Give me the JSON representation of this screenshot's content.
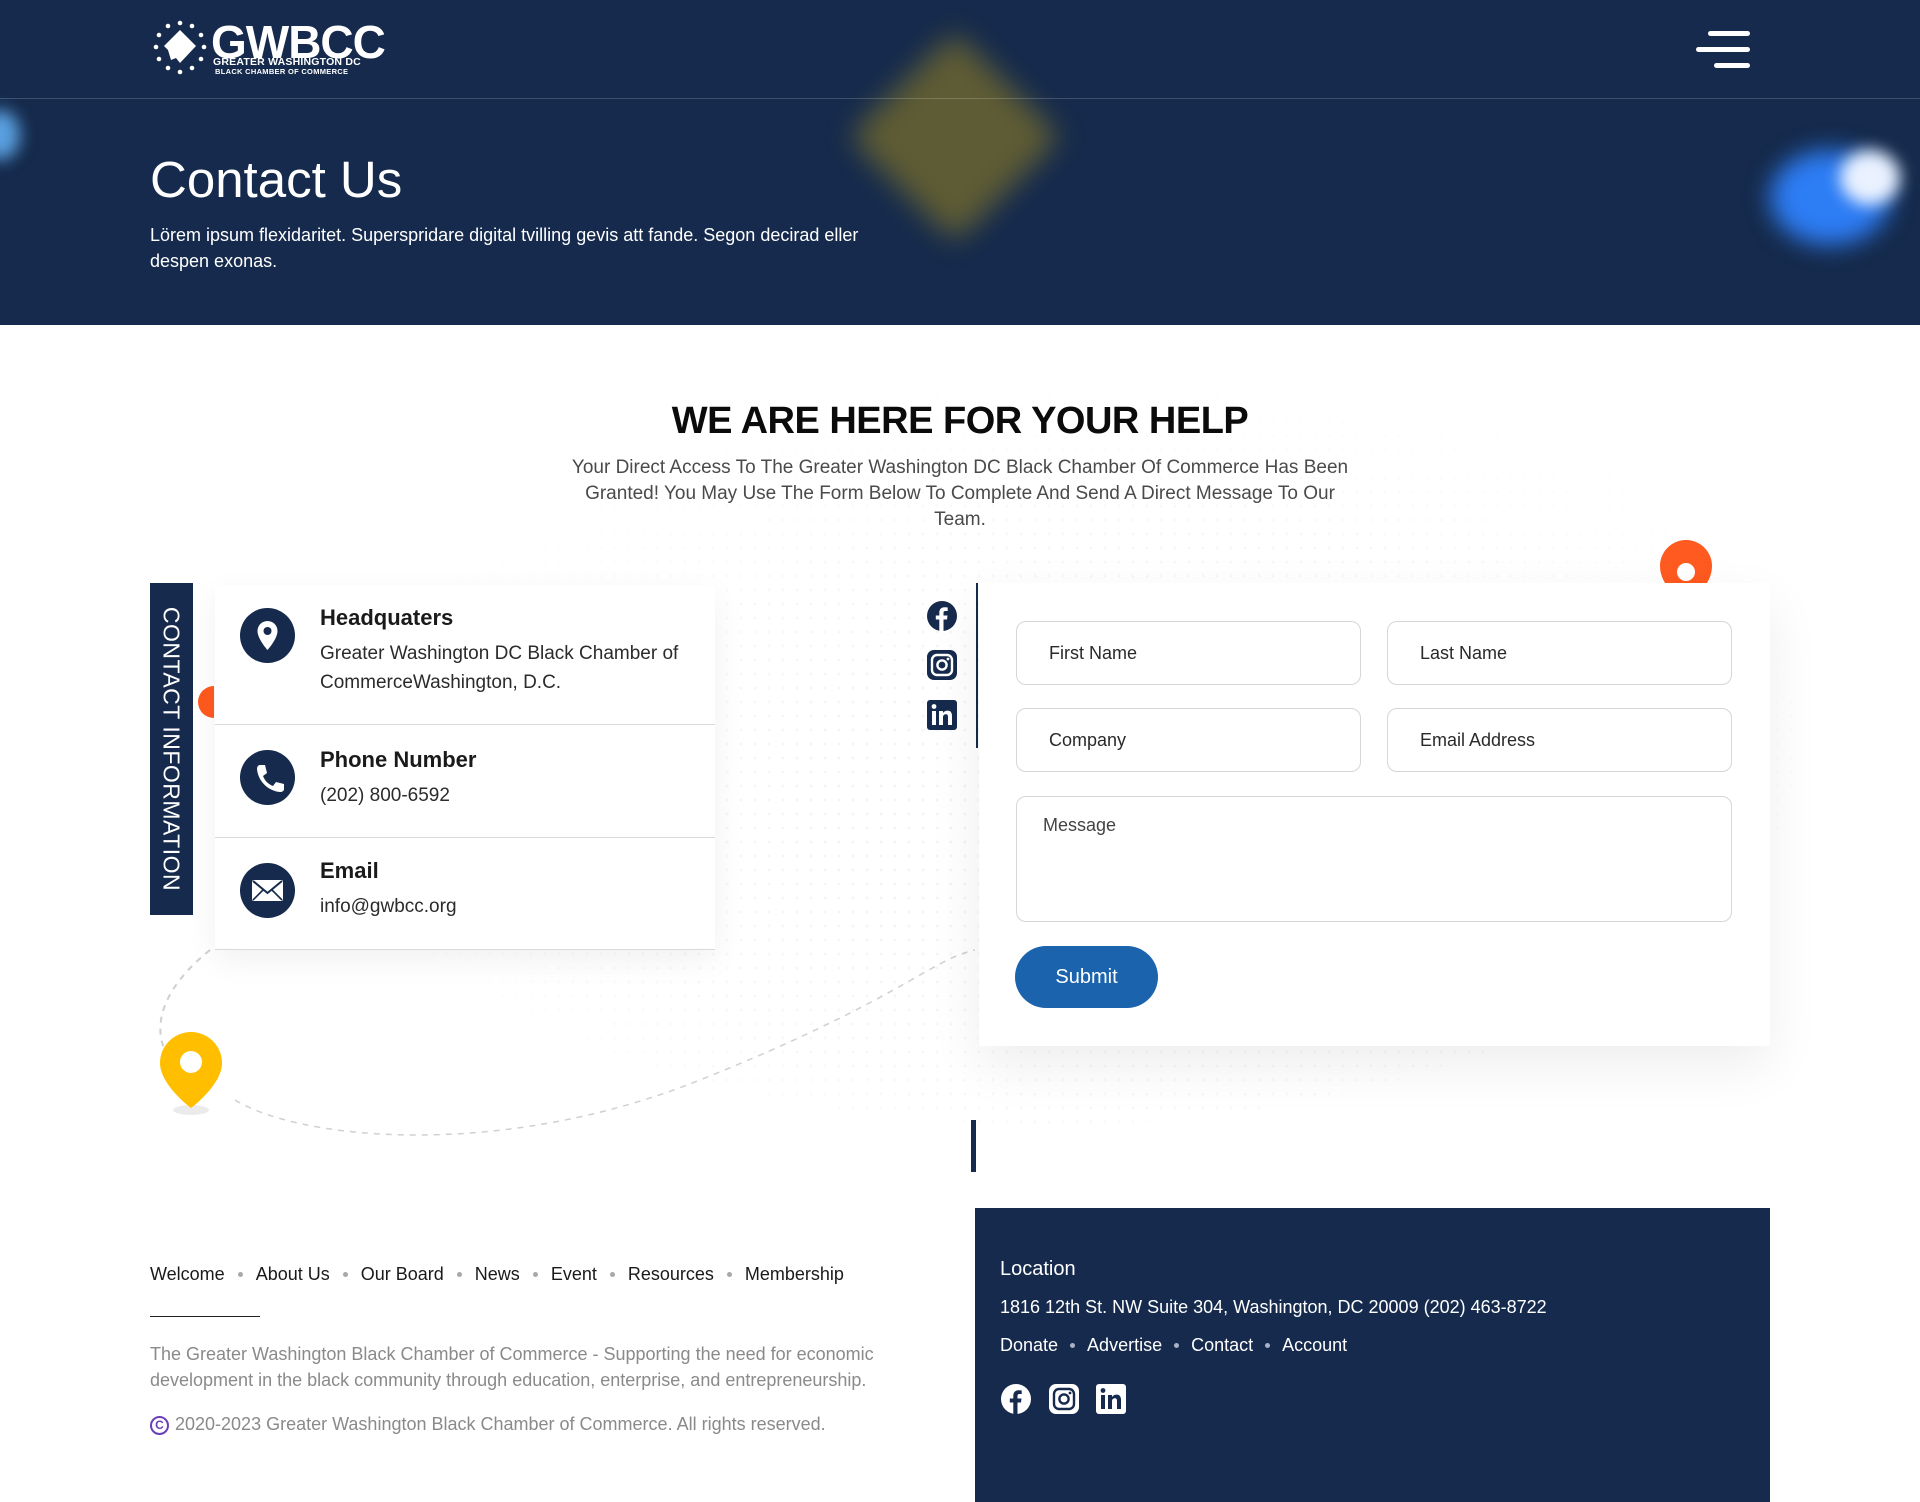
{
  "header": {
    "logo_text": "GWBCC",
    "logo_line1": "GREATER WASHINGTON DC",
    "logo_line2": "BLACK CHAMBER OF COMMERCE",
    "menu_icon": "hamburger-menu-icon"
  },
  "hero": {
    "title": "Contact Us",
    "subtitle": "Lörem ipsum flexidaritet. Superspridare digital tvilling gevis att fande. Segon decirad eller despen exonas."
  },
  "section": {
    "title": "WE ARE HERE FOR YOUR HELP",
    "description": "Your Direct Access To The Greater Washington DC Black Chamber Of Commerce Has Been Granted! You May Use The Form Below To Complete And Send A Direct Message To Our Team."
  },
  "contact_info": {
    "tab_label": "CONTACT INFORMATION",
    "items": [
      {
        "icon": "location-pin-icon",
        "title": "Headquaters",
        "text": "Greater Washington DC Black Chamber of CommerceWashington, D.C."
      },
      {
        "icon": "phone-icon",
        "title": "Phone Number",
        "text": "(202) 800-6592"
      },
      {
        "icon": "envelope-icon",
        "title": "Email",
        "text": "info@gwbcc.org"
      }
    ]
  },
  "social": [
    "facebook-icon",
    "instagram-icon",
    "linkedin-icon"
  ],
  "form": {
    "first_name_placeholder": "First Name",
    "last_name_placeholder": "Last Name",
    "company_placeholder": "Company",
    "email_placeholder": "Email Address",
    "message_placeholder": "Message",
    "submit_label": "Submit"
  },
  "footer": {
    "nav": [
      "Welcome",
      "About Us",
      "Our Board",
      "News",
      "Event",
      "Resources",
      "Membership"
    ],
    "description": "The Greater Washington Black Chamber of Commerce - Supporting the need for economic development in the black community through education, enterprise, and entrepreneurship.",
    "copyright": "2020-2023 Greater Washington Black Chamber of Commerce. All rights reserved.",
    "copyright_symbol": "C",
    "location_title": "Location",
    "address": "1816 12th St. NW Suite 304, Washington, DC 20009 (202) 463-8722",
    "secondary_nav": [
      "Donate",
      "Advertise",
      "Contact",
      "Account"
    ]
  },
  "colors": {
    "navy": "#152a4c",
    "button_blue": "#1b64ad",
    "accent_orange": "#ff5a1f",
    "accent_yellow": "#ffbf00"
  }
}
